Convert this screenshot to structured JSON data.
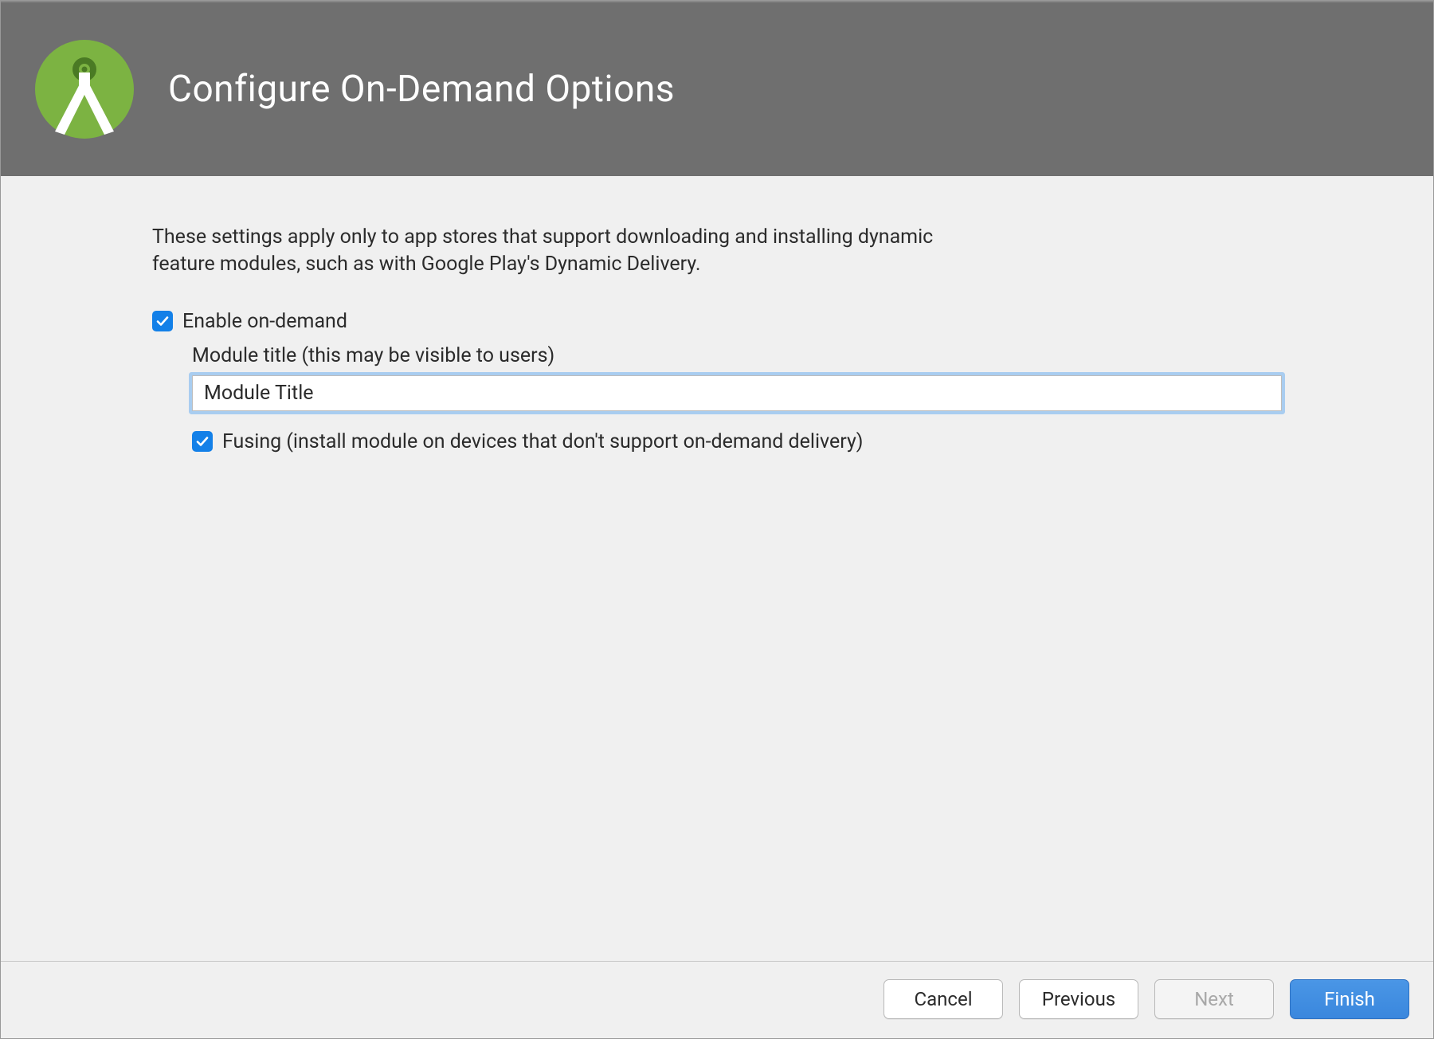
{
  "header": {
    "title": "Configure On-Demand Options"
  },
  "main": {
    "description": "These settings apply only to app stores that support downloading and installing dynamic feature modules, such as with Google Play's Dynamic Delivery.",
    "enable_on_demand": {
      "label": "Enable on-demand",
      "checked": true
    },
    "module_title": {
      "label": "Module title (this may be visible to users)",
      "value": "Module Title"
    },
    "fusing": {
      "label": "Fusing (install module on devices that don't support on-demand delivery)",
      "checked": true
    }
  },
  "footer": {
    "cancel": "Cancel",
    "previous": "Previous",
    "next": "Next",
    "finish": "Finish",
    "next_enabled": false
  },
  "colors": {
    "accent": "#3f8fe2",
    "checkbox": "#1380e8",
    "header_bg": "#6f6f6f",
    "logo_green": "#7cb342"
  }
}
